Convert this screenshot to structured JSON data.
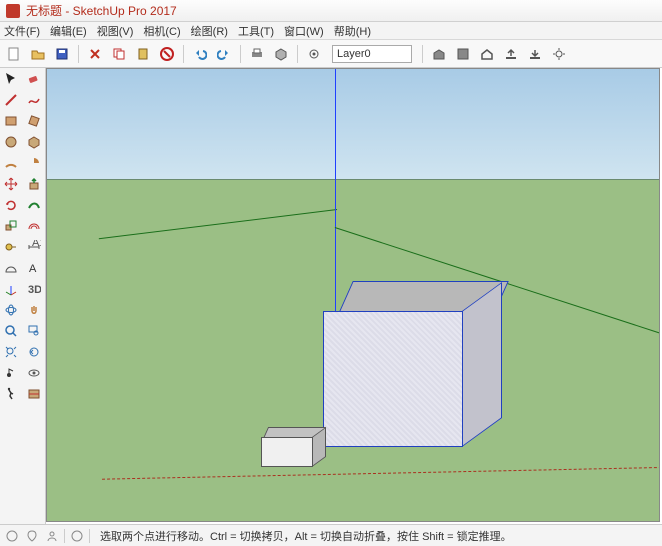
{
  "app": {
    "title": "无标题 - SketchUp Pro 2017"
  },
  "menu": {
    "file": "文件(F)",
    "edit": "编辑(E)",
    "view": "视图(V)",
    "camera": "相机(C)",
    "draw": "绘图(R)",
    "tools": "工具(T)",
    "window": "窗口(W)",
    "help": "帮助(H)"
  },
  "toolbar": {
    "layer_label": "Layer0",
    "icons": {
      "new": "new-file-icon",
      "open": "open-file-icon",
      "save": "save-icon",
      "cut": "cut-icon",
      "copy": "copy-icon",
      "paste": "paste-icon",
      "delete": "delete-icon",
      "undo": "undo-icon",
      "redo": "redo-icon",
      "print": "print-icon",
      "model": "model-icon",
      "warehouse": "warehouse-icon",
      "extension": "extension-icon",
      "home": "home-icon",
      "upload": "upload-icon",
      "settings": "settings-icon"
    }
  },
  "left_tools": [
    "select-icon",
    "eraser-icon",
    "line-icon",
    "freehand-icon",
    "rect-icon",
    "rotated-rect-icon",
    "circle-icon",
    "polygon-icon",
    "arc-icon",
    "pie-icon",
    "move-icon",
    "pushpull-icon",
    "rotate-icon",
    "followme-icon",
    "scale-icon",
    "offset-icon",
    "tape-icon",
    "dimension-icon",
    "protractor-icon",
    "text-icon",
    "axes-icon",
    "3dtext-icon",
    "orbit-icon",
    "pan-icon",
    "zoom-icon",
    "zoomwindow-icon",
    "zoomextents-icon",
    "previous-icon",
    "position-icon",
    "lookaround-icon",
    "walk-icon",
    "section-icon"
  ],
  "viewport": {
    "axes": {
      "blue": "#2040ff",
      "red": "#aa3020",
      "green": "#1a6e1a"
    },
    "objects": [
      {
        "name": "large-cube",
        "selected": true
      },
      {
        "name": "small-box",
        "selected": false
      }
    ]
  },
  "status": {
    "hint": "选取两个点进行移动。Ctrl = 切换拷贝，Alt = 切换自动折叠，按住 Shift = 锁定推理。",
    "icons": [
      "map-icon",
      "geo-icon",
      "user-icon",
      "info-icon"
    ]
  }
}
